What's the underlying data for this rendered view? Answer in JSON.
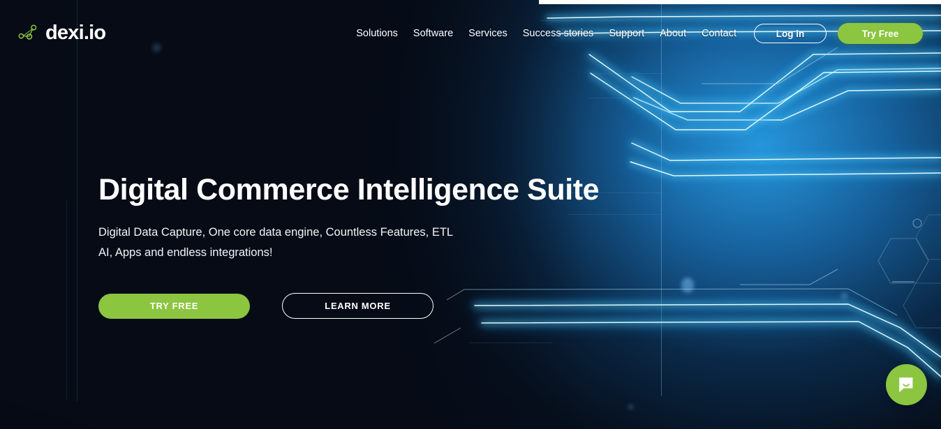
{
  "brand": {
    "logo_text": "dexi.io",
    "logo_icon": "network-nodes-icon",
    "accent_green": "#8cc540",
    "glow_blue": "#29abe2",
    "background_dark": "#060b16"
  },
  "nav": {
    "items": [
      {
        "label": "Solutions"
      },
      {
        "label": "Software"
      },
      {
        "label": "Services"
      },
      {
        "label": "Success stories"
      },
      {
        "label": "Support"
      },
      {
        "label": "About"
      },
      {
        "label": "Contact"
      }
    ],
    "login_label": "Log in",
    "tryfree_label": "Try Free"
  },
  "hero": {
    "title": "Digital Commerce Intelligence Suite",
    "subtitle_line1": "Digital Data Capture, One core data engine, Countless Features, ETL",
    "subtitle_line2": "AI, Apps and endless integrations!",
    "primary_cta": "TRY FREE",
    "secondary_cta": "LEARN MORE"
  },
  "chat": {
    "icon": "chat-bubble-smile-icon"
  }
}
